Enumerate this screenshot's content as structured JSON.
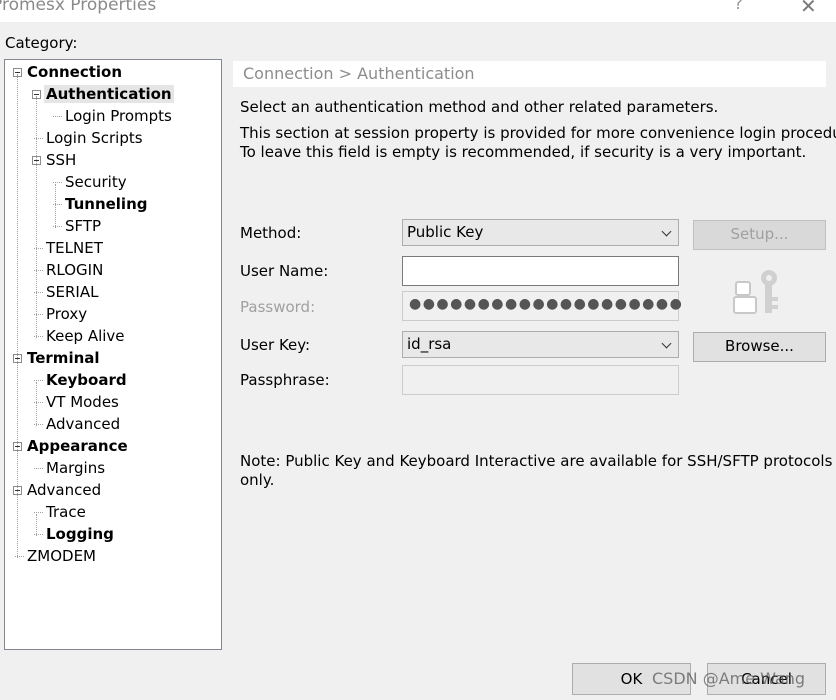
{
  "window": {
    "title": "Promesx Properties",
    "help": "?",
    "close": "✕"
  },
  "category_label": "Category:",
  "tree": [
    {
      "label": "Connection",
      "level": 0,
      "bold": true,
      "expander": true
    },
    {
      "label": "Authentication",
      "level": 1,
      "bold": true,
      "expander": true,
      "selected": true
    },
    {
      "label": "Login Prompts",
      "level": 2,
      "bold": false,
      "expander": false
    },
    {
      "label": "Login Scripts",
      "level": 1,
      "bold": false,
      "expander": false
    },
    {
      "label": "SSH",
      "level": 1,
      "bold": false,
      "expander": true
    },
    {
      "label": "Security",
      "level": 2,
      "bold": false,
      "expander": false
    },
    {
      "label": "Tunneling",
      "level": 2,
      "bold": true,
      "expander": false
    },
    {
      "label": "SFTP",
      "level": 2,
      "bold": false,
      "expander": false
    },
    {
      "label": "TELNET",
      "level": 1,
      "bold": false,
      "expander": false
    },
    {
      "label": "RLOGIN",
      "level": 1,
      "bold": false,
      "expander": false
    },
    {
      "label": "SERIAL",
      "level": 1,
      "bold": false,
      "expander": false
    },
    {
      "label": "Proxy",
      "level": 1,
      "bold": false,
      "expander": false
    },
    {
      "label": "Keep Alive",
      "level": 1,
      "bold": false,
      "expander": false
    },
    {
      "label": "Terminal",
      "level": 0,
      "bold": true,
      "expander": true
    },
    {
      "label": "Keyboard",
      "level": 1,
      "bold": true,
      "expander": false
    },
    {
      "label": "VT Modes",
      "level": 1,
      "bold": false,
      "expander": false
    },
    {
      "label": "Advanced",
      "level": 1,
      "bold": false,
      "expander": false
    },
    {
      "label": "Appearance",
      "level": 0,
      "bold": true,
      "expander": true
    },
    {
      "label": "Margins",
      "level": 1,
      "bold": false,
      "expander": false
    },
    {
      "label": "Advanced",
      "level": 0,
      "bold": false,
      "expander": true
    },
    {
      "label": "Trace",
      "level": 1,
      "bold": false,
      "expander": false
    },
    {
      "label": "Logging",
      "level": 1,
      "bold": true,
      "expander": false
    },
    {
      "label": "ZMODEM",
      "level": 0,
      "bold": false,
      "expander": false
    }
  ],
  "panel": {
    "breadcrumb": "Connection > Authentication",
    "intro": "Select an authentication method and other related parameters.",
    "desc1": "This section at session property is provided for more convenience login procedure.",
    "desc2": "To leave this field is empty is recommended, if security is a very important.",
    "method_label": "Method:",
    "method_value": "Public Key",
    "setup_button": "Setup...",
    "username_label": "User Name:",
    "username_value": "",
    "password_label": "Password:",
    "password_value": "●●●●●●●●●●●●●●●●●●●●",
    "userkey_label": "User Key:",
    "userkey_value": "id_rsa",
    "browse_button": "Browse...",
    "passphrase_label": "Passphrase:",
    "note1": "Note: Public Key and Keyboard Interactive are available for SSH/SFTP protocols",
    "note2": "only."
  },
  "footer": {
    "ok": "OK",
    "cancel": "Cancel",
    "watermark": "CSDN @Ame Wang"
  },
  "icons": {
    "user_key": "user-key-icon",
    "expander": "collapse-icon"
  }
}
